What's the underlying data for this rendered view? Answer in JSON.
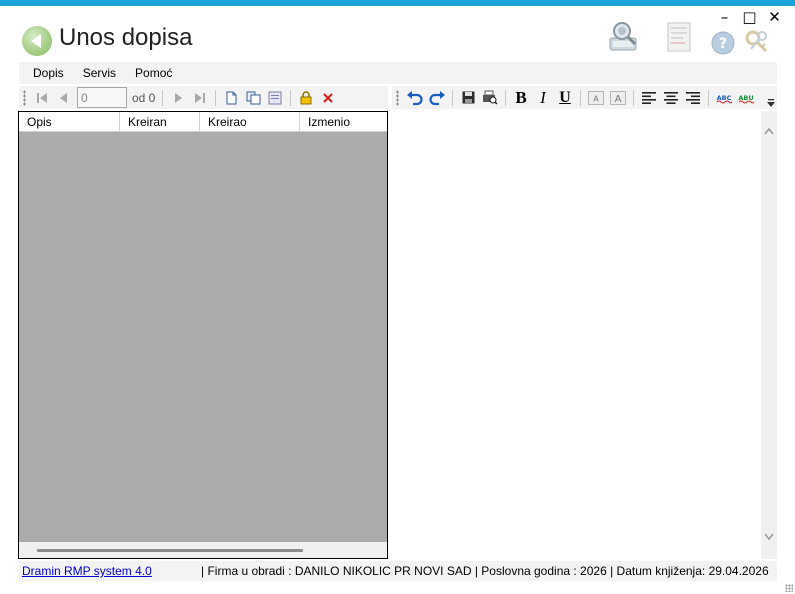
{
  "window": {
    "title": "Unos dopisa",
    "controls": {
      "minimize": "–",
      "maximize": "□",
      "close": "✕"
    }
  },
  "menu": {
    "items": [
      "Dopis",
      "Servis",
      "Pomoć"
    ]
  },
  "navigator": {
    "position": "0",
    "of_label": "od 0"
  },
  "grid": {
    "columns": [
      "Opis",
      "Kreiran",
      "Kreirao",
      "Izmenio"
    ]
  },
  "status": {
    "link": "Dramin RMP system 4.0",
    "text": "|  Firma u obradi : DANILO NIKOLIC PR NOVI SAD  |  Poslovna godina : 2026  |  Datum knjiženja: 29.04.2026"
  },
  "format": {
    "bold": "B",
    "italic": "I",
    "underline": "U",
    "font_size_up": "A",
    "font_size_down": "A",
    "spell": "ABC",
    "spell_alt": "ABU"
  },
  "colors": {
    "accent_strip": "#1aa3d9",
    "grid_bg": "#ababab",
    "delete_red": "#d81e1e",
    "undo_blue": "#1a5fbf"
  },
  "icons": [
    "back-arrow-icon",
    "search-user-icon",
    "document-icon",
    "help-icon",
    "keys-icon"
  ]
}
